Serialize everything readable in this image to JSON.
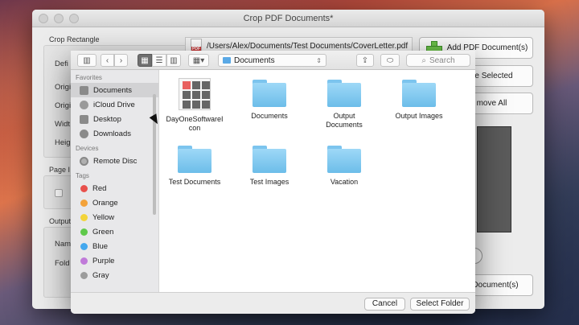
{
  "main_window": {
    "title": "Crop PDF Documents*",
    "crop_rectangle_title": "Crop Rectangle",
    "page_title": "Page I",
    "output_title": "Output",
    "labels": [
      "Defi",
      "Origi",
      "Origi",
      "Widt",
      "Heig"
    ],
    "output_labels": [
      "Nam",
      "Fold"
    ],
    "file_path": "/Users/Alex/Documents/Test Documents/CoverLetter.pdf",
    "add_button": "Add PDF Document(s)",
    "remove_selected": "ve Selected",
    "remove_all": "move All",
    "bottom_button": "F Document(s)"
  },
  "toolbar": {
    "location": "Documents",
    "search_placeholder": "Search"
  },
  "sidebar": {
    "favorites_header": "Favorites",
    "favorites": [
      {
        "label": "Documents",
        "icon": "documents-icon",
        "selected": true
      },
      {
        "label": "iCloud Drive",
        "icon": "cloud-icon"
      },
      {
        "label": "Desktop",
        "icon": "desktop-icon"
      },
      {
        "label": "Downloads",
        "icon": "downloads-icon"
      }
    ],
    "devices_header": "Devices",
    "devices": [
      {
        "label": "Remote Disc",
        "icon": "disc-icon"
      }
    ],
    "tags_header": "Tags",
    "tags": [
      {
        "label": "Red",
        "color": "#e8504c"
      },
      {
        "label": "Orange",
        "color": "#f3a23a"
      },
      {
        "label": "Yellow",
        "color": "#f3d43a"
      },
      {
        "label": "Green",
        "color": "#5fc94a"
      },
      {
        "label": "Blue",
        "color": "#44a8ee"
      },
      {
        "label": "Purple",
        "color": "#c07ad9"
      },
      {
        "label": "Gray",
        "color": "#9c9c9c"
      }
    ]
  },
  "files": [
    {
      "name": "DayOneSoftwareI\ncon",
      "type": "app-icon"
    },
    {
      "name": "Documents",
      "type": "folder"
    },
    {
      "name": "Output\nDocuments",
      "type": "folder"
    },
    {
      "name": "Output Images",
      "type": "folder"
    },
    {
      "name": "Test Documents",
      "type": "folder"
    },
    {
      "name": "Test Images",
      "type": "folder"
    },
    {
      "name": "Vacation",
      "type": "folder"
    }
  ],
  "footer": {
    "cancel": "Cancel",
    "select": "Select Folder"
  }
}
